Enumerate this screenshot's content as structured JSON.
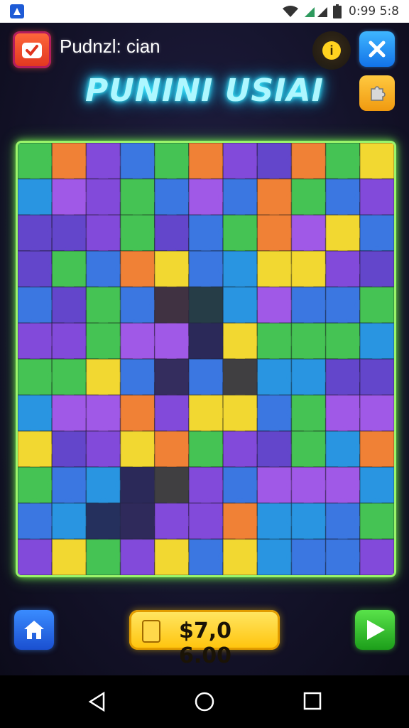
{
  "status_bar": {
    "time": "0:99 5:8",
    "icons": [
      "app-notification-icon",
      "wifi-icon",
      "signal-icon",
      "battery-icon"
    ]
  },
  "header": {
    "app_title": "Pudnzl: cian",
    "neon_title": "PUNINI USIAI",
    "hint_label": "i"
  },
  "board": {
    "rows": 12,
    "cols": 11,
    "palette": [
      "#7b3fd8",
      "#2f6fe0",
      "#f2d625",
      "#3ac04a",
      "#f07a2a",
      "#9b4fe6",
      "#1c8fe0",
      "#5a3bc8"
    ]
  },
  "footer": {
    "coins": "$7,0 6.00"
  },
  "colors": {
    "accent_frame": "#9af36a",
    "neon": "#3ef0ff",
    "coin": "#ffc30a"
  }
}
